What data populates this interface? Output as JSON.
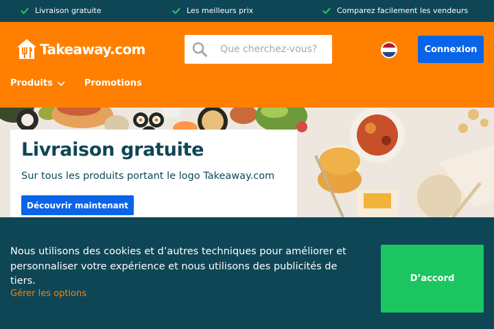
{
  "usp_bar": {
    "items": [
      {
        "label": "Livraison gratuite"
      },
      {
        "label": "Les meilleurs prix"
      },
      {
        "label": "Comparez facilement les vendeurs"
      }
    ],
    "check_color": "#1bc661",
    "check_icon": "check-icon"
  },
  "header": {
    "background": "#ff8000",
    "logo_text": "Takeaway.com",
    "search": {
      "placeholder": "Que cherchez-vous?",
      "value": "",
      "icon": "search-icon"
    },
    "language_flag": "netherlands-flag-icon",
    "login_label": "Connexion"
  },
  "nav": {
    "items": [
      {
        "label": "Produits",
        "has_dropdown": true
      },
      {
        "label": "Promotions",
        "has_dropdown": false
      }
    ]
  },
  "hero": {
    "title": "Livraison gratuite",
    "subtitle": "Sur tous les produits portant le logo Takeaway.com",
    "button_label": "Découvrir maintenant"
  },
  "cookie_banner": {
    "text": "Nous utilisons des cookies et d’autres techniques pour améliorer et personnaliser votre expérience et nous utilisons des publicités de tiers.",
    "manage_label": "Gérer les options",
    "accept_label": "D’accord"
  },
  "colors": {
    "dark_teal": "#0e4656",
    "orange": "#ff8000",
    "primary_blue": "#0a64e8",
    "accept_green": "#1bc661"
  }
}
